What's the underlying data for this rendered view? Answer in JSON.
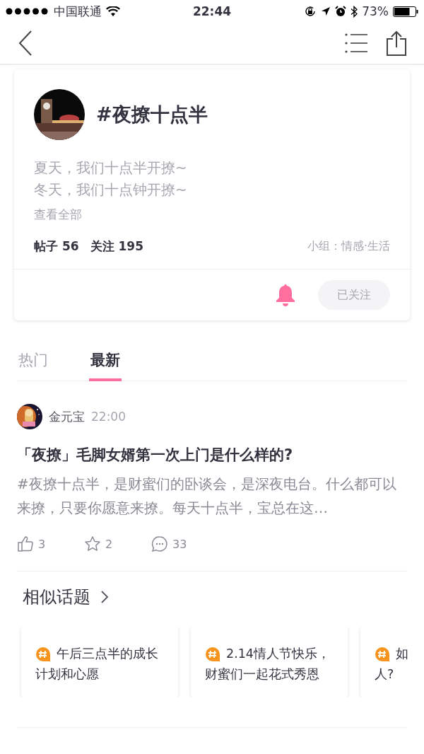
{
  "status_bar": {
    "carrier": "中国联通",
    "time": "22:44",
    "battery": "73%"
  },
  "topic": {
    "title": "#夜撩十点半",
    "description": [
      "夏天，我们十点半开撩~",
      "冬天，我们十点钟开撩~"
    ],
    "more": "查看全部",
    "stats": [
      {
        "label": "帖子",
        "value": "56"
      },
      {
        "label": "关注",
        "value": "195"
      }
    ],
    "group": "小组：情感·生活",
    "notify_on": true,
    "follow_button": {
      "label": "已关注",
      "followed": true
    }
  },
  "tabs": [
    {
      "label": "热门",
      "selected": false
    },
    {
      "label": "最新",
      "selected": true
    }
  ],
  "post": {
    "author": "金元宝",
    "time": "22:00",
    "title": "「夜撩」毛脚女婿第一次上门是什么样的?",
    "body": "#夜撩十点半，是财蜜们的卧谈会，是深夜电台。什么都可以来撩，只要你愿意来撩。每天十点半，宝总在这…",
    "likes": "3",
    "favorites": "2",
    "comments": "33"
  },
  "similar": {
    "title": "相似话题",
    "topics": [
      {
        "lines": [
          "午后三点半的成长",
          "计划和心愿"
        ]
      },
      {
        "lines": [
          "2.14情人节快乐，",
          "财蜜们一起花式秀恩"
        ]
      },
      {
        "lines": [
          "如",
          "人?"
        ]
      }
    ]
  }
}
